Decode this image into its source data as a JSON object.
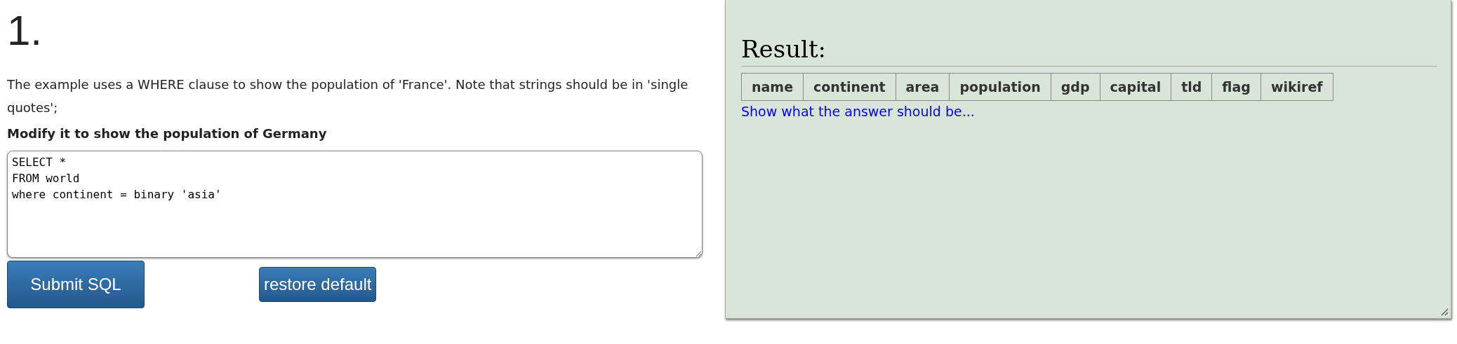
{
  "question": {
    "number": "1.",
    "description": "The example uses a WHERE clause to show the population of 'France'. Note that strings should be in 'single quotes';",
    "task": "Modify it to show the population of Germany"
  },
  "editor": {
    "value": "SELECT *\nFROM world\nwhere continent = binary 'asia'"
  },
  "buttons": [
    {
      "kind": "submit",
      "label": "Submit SQL"
    },
    {
      "kind": "restore",
      "label": "restore default"
    }
  ],
  "result": {
    "title": "Result:",
    "columns": [
      "name",
      "continent",
      "area",
      "population",
      "gdp",
      "capital",
      "tld",
      "flag",
      "wikiref"
    ],
    "link": "Show what the answer should be..."
  }
}
